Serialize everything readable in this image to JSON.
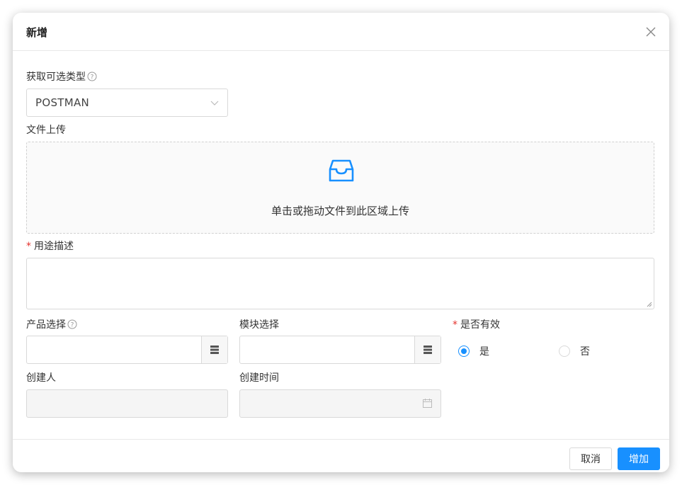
{
  "dialog": {
    "title": "新增",
    "close_icon": "close-icon"
  },
  "form": {
    "type_field": {
      "label": "获取可选类型",
      "value": "POSTMAN"
    },
    "upload_field": {
      "label": "文件上传",
      "hint": "单击或拖动文件到此区域上传",
      "icon": "inbox-icon",
      "icon_color": "#1890ff"
    },
    "purpose_field": {
      "required_mark": "*",
      "label": "用途描述",
      "value": ""
    },
    "product_field": {
      "label": "产品选择",
      "value": ""
    },
    "module_field": {
      "label": "模块选择",
      "value": ""
    },
    "valid_field": {
      "required_mark": "*",
      "label": "是否有效",
      "options": [
        {
          "label": "是",
          "checked": true
        },
        {
          "label": "否",
          "checked": false
        }
      ]
    },
    "creator_field": {
      "label": "创建人",
      "value": ""
    },
    "created_time_field": {
      "label": "创建时间",
      "value": ""
    }
  },
  "footer": {
    "cancel_label": "取消",
    "add_label": "增加"
  },
  "colors": {
    "primary": "#1890ff",
    "required": "#e5322d"
  }
}
